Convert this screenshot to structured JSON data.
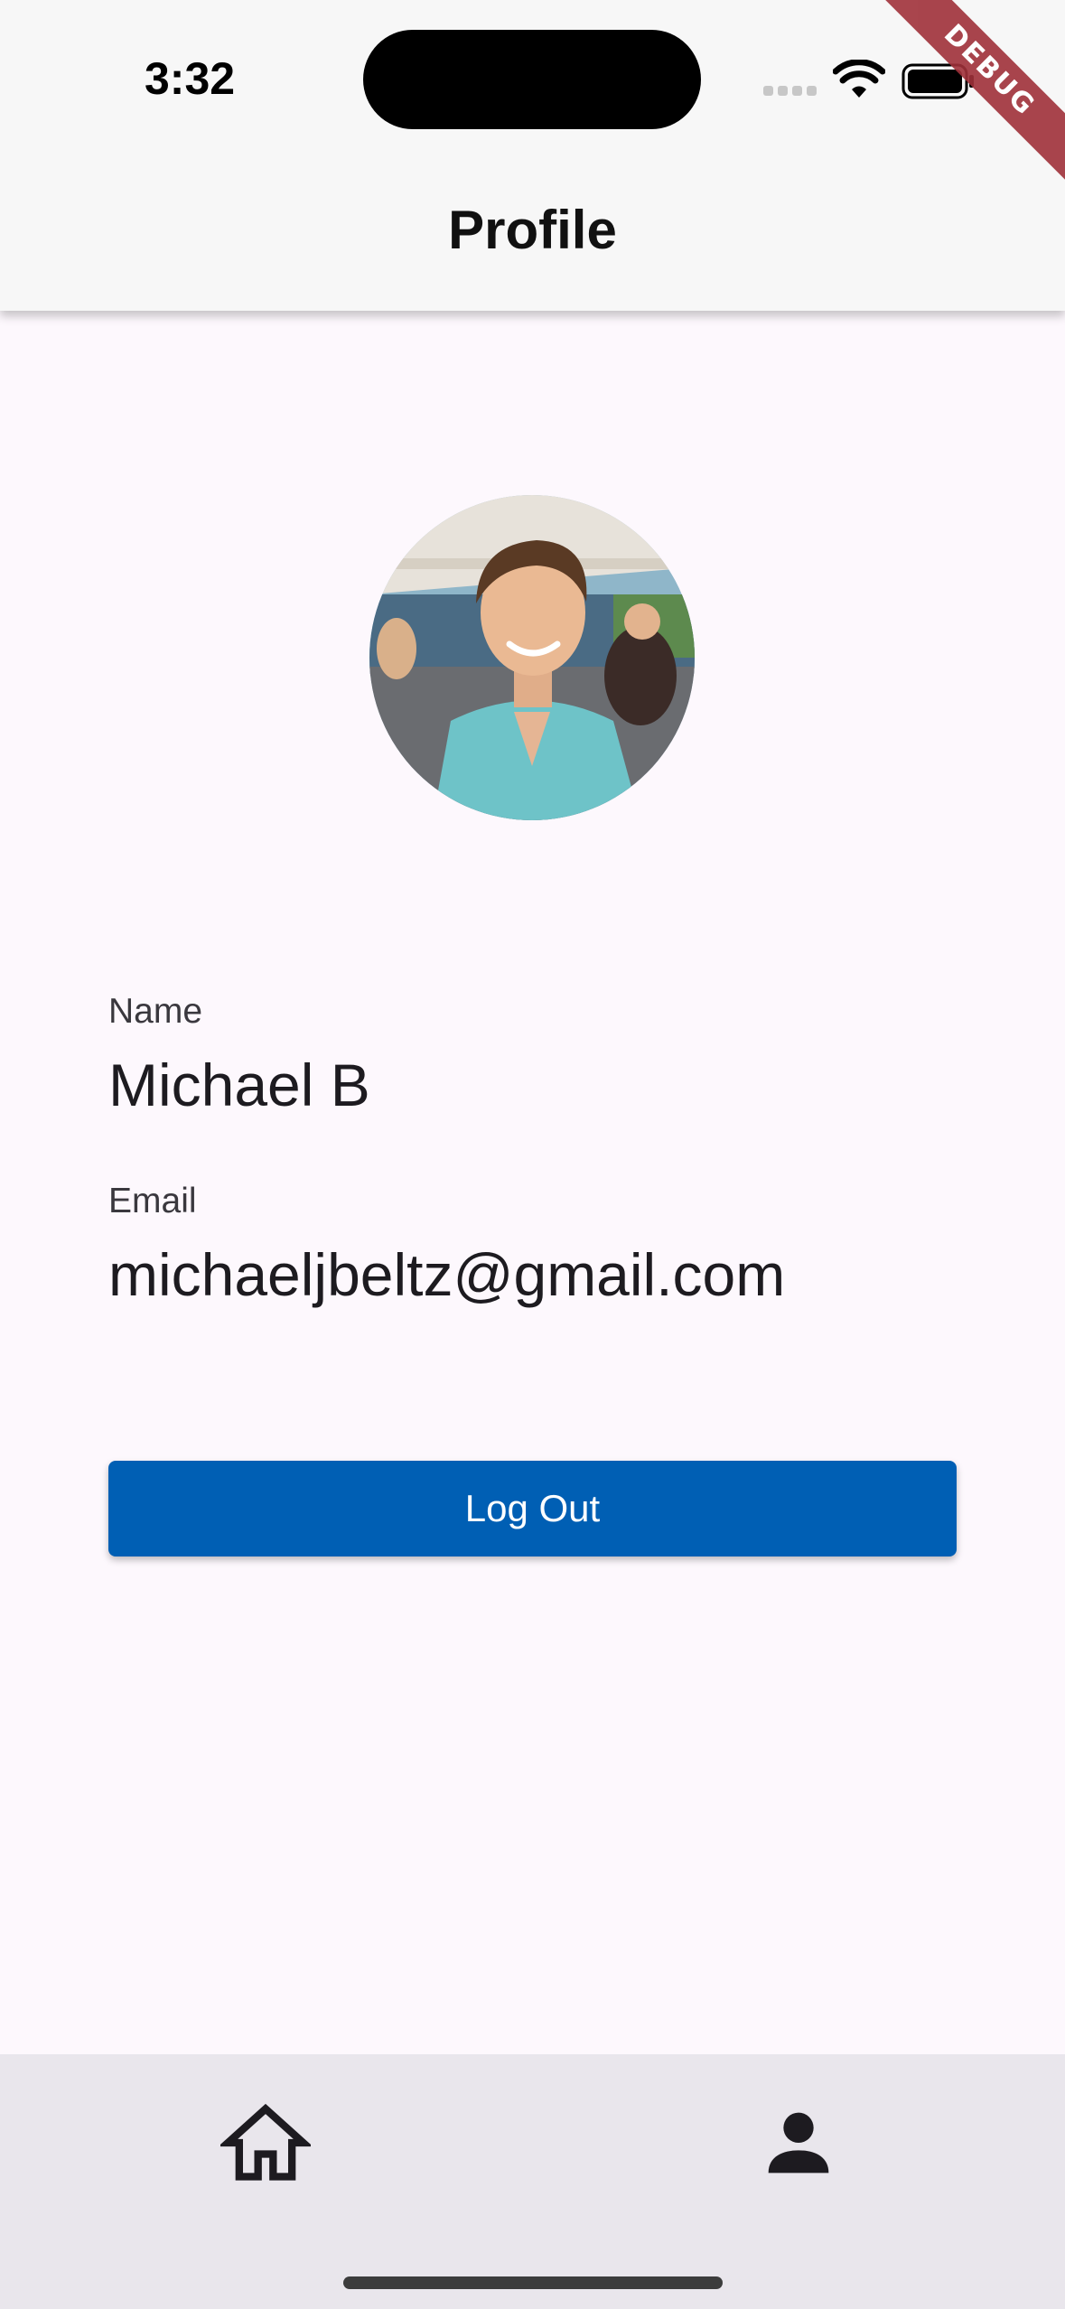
{
  "status_bar": {
    "time": "3:32",
    "icons": [
      "cellular-signal-icon",
      "wifi-icon",
      "battery-icon"
    ]
  },
  "debug_banner": "DEBUG",
  "app_bar": {
    "title": "Profile"
  },
  "profile": {
    "name_label": "Name",
    "name_value": "Michael B",
    "email_label": "Email",
    "email_value": "michaeljbeltz@gmail.com"
  },
  "actions": {
    "logout_label": "Log Out"
  },
  "bottom_nav": {
    "items": [
      {
        "icon": "home-icon"
      },
      {
        "icon": "person-icon"
      }
    ]
  },
  "colors": {
    "primary": "#005fb4",
    "background": "#fdf8fd",
    "app_bar": "#f7f7f7",
    "nav_bar": "#e9e6ec",
    "debug_ribbon": "#a0313a"
  }
}
